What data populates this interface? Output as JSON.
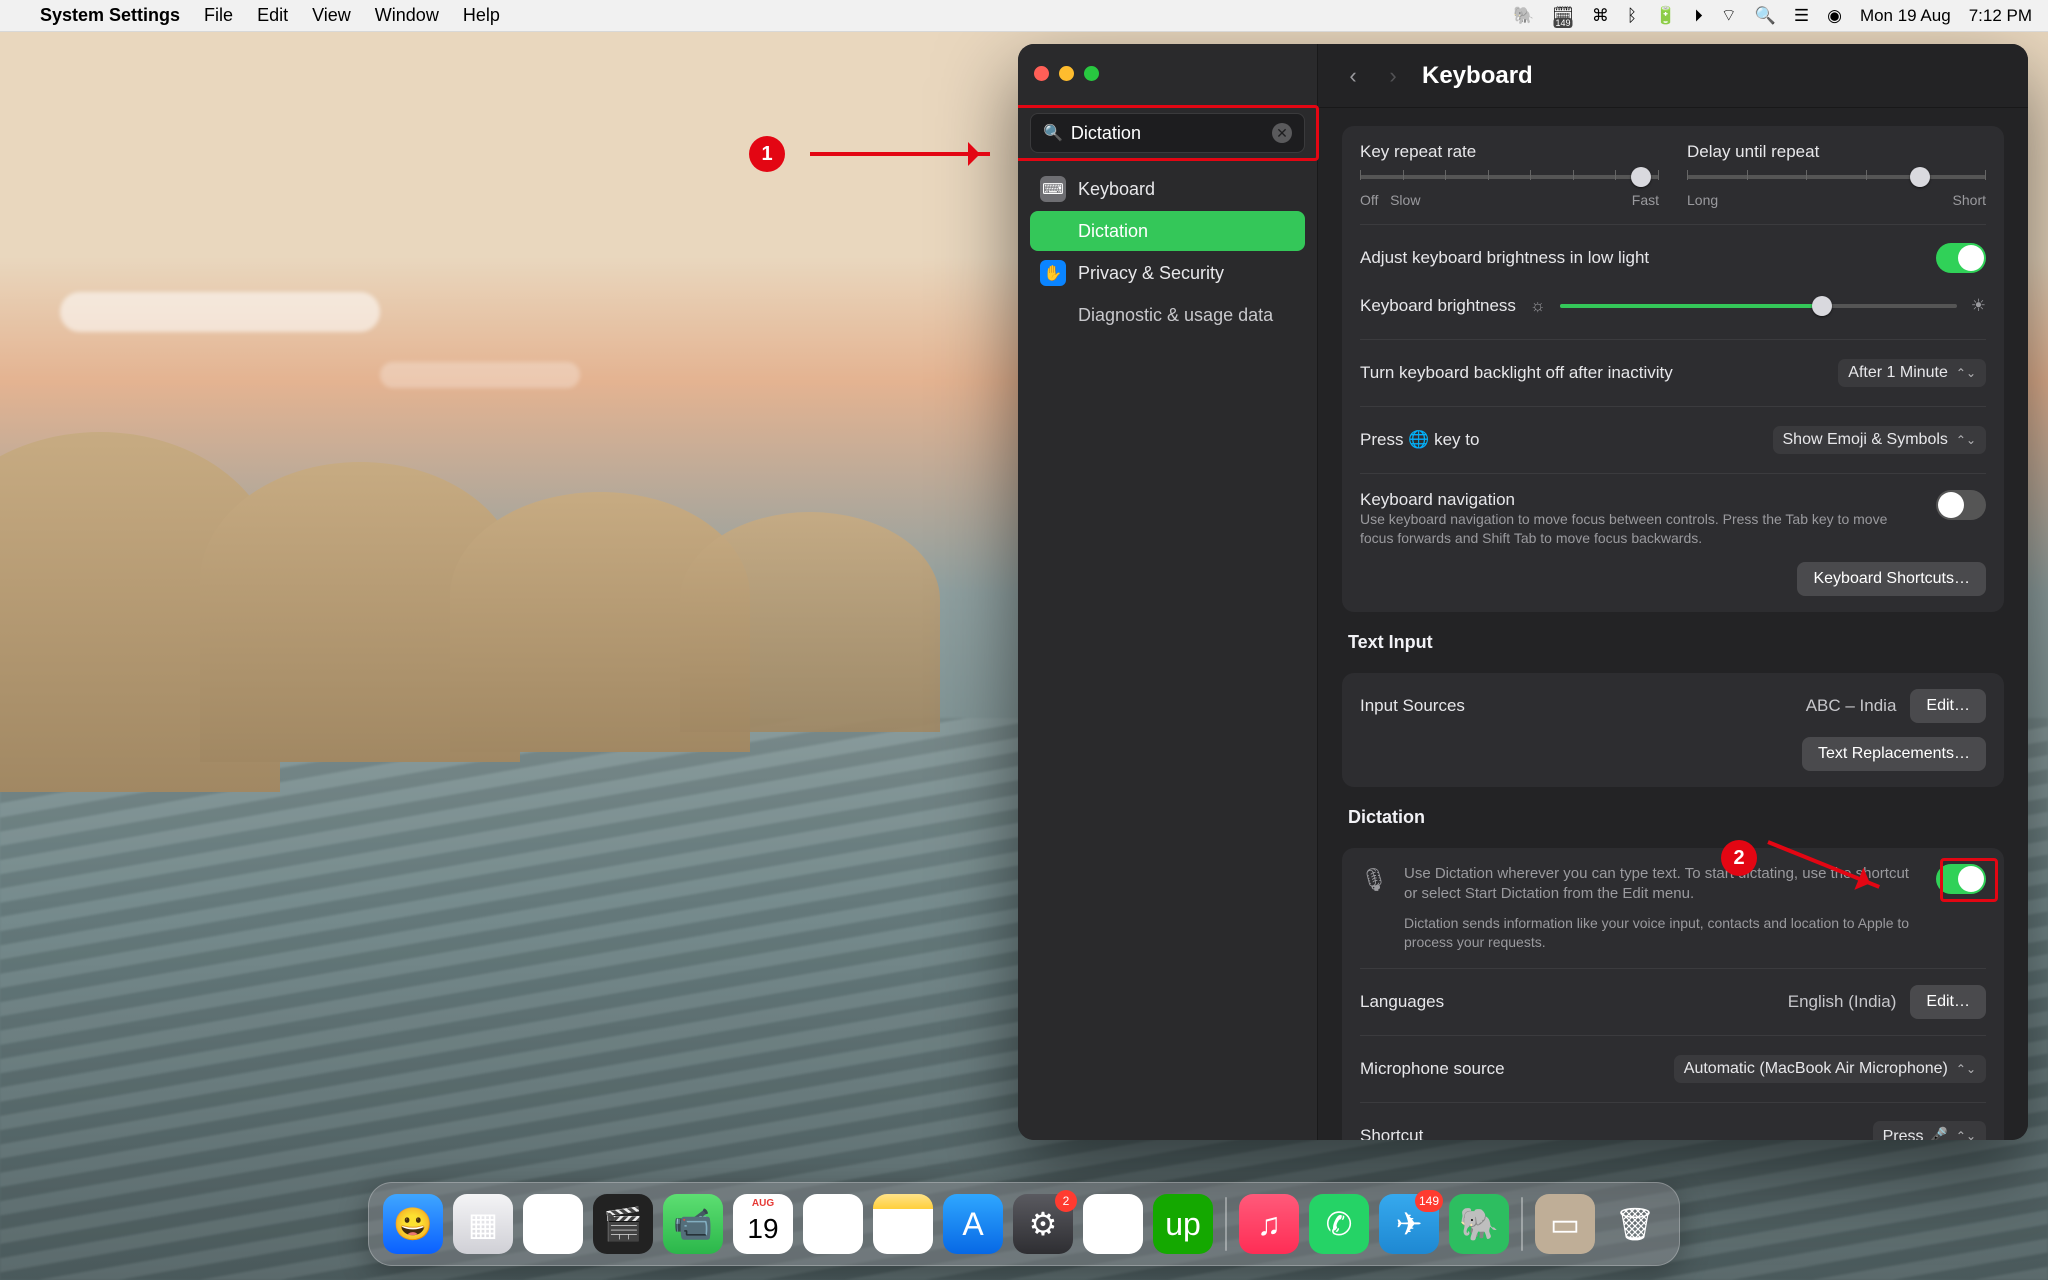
{
  "menubar": {
    "app": "System Settings",
    "items": [
      "File",
      "Edit",
      "View",
      "Window",
      "Help"
    ],
    "date": "Mon 19 Aug",
    "time": "7:12 PM",
    "calbadge": "149"
  },
  "sidebar": {
    "search_value": "Dictation",
    "items": [
      {
        "icon": "grey",
        "glyph": "⌨",
        "label": "Keyboard",
        "selected": false
      },
      {
        "icon": "",
        "glyph": "",
        "label": "Dictation",
        "selected": true
      },
      {
        "icon": "blue",
        "glyph": "✋",
        "label": "Privacy & Security",
        "selected": false
      },
      {
        "icon": "",
        "glyph": "",
        "label": "Diagnostic & usage data",
        "selected": false,
        "sub": true
      }
    ]
  },
  "header": {
    "title": "Keyboard"
  },
  "keycard": {
    "repeat_label": "Key repeat rate",
    "repeat_left": "Off",
    "repeat_left2": "Slow",
    "repeat_right": "Fast",
    "delay_label": "Delay until repeat",
    "delay_left": "Long",
    "delay_right": "Short",
    "brightauto_label": "Adjust keyboard brightness in low light",
    "bright_label": "Keyboard brightness",
    "backlightoff_label": "Turn keyboard backlight off after inactivity",
    "backlightoff_value": "After 1 Minute",
    "globe_label": "Press 🌐 key to",
    "globe_value": "Show Emoji & Symbols",
    "nav_label": "Keyboard navigation",
    "nav_help": "Use keyboard navigation to move focus between controls. Press the Tab key to move focus forwards and Shift Tab to move focus backwards.",
    "shortcuts_btn": "Keyboard Shortcuts…"
  },
  "textinput": {
    "title": "Text Input",
    "sources_label": "Input Sources",
    "sources_value": "ABC – India",
    "edit_btn": "Edit…",
    "replacements_btn": "Text Replacements…"
  },
  "dictation": {
    "title": "Dictation",
    "desc": "Use Dictation wherever you can type text. To start dictating, use the shortcut or select Start Dictation from the Edit menu.",
    "privacy": "Dictation sends information like your voice input, contacts and location to Apple to process your requests.",
    "lang_label": "Languages",
    "lang_value": "English (India)",
    "edit_btn": "Edit…",
    "mic_label": "Microphone source",
    "mic_value": "Automatic (MacBook Air Microphone)",
    "shortcut_label": "Shortcut",
    "shortcut_value": "Press 🎤"
  },
  "annotations": {
    "a1": "1",
    "a2": "2"
  },
  "dock": {
    "items": [
      {
        "name": "finder",
        "bg": "linear-gradient(#3fa6ff,#0a60ff)",
        "glyph": "😀"
      },
      {
        "name": "launchpad",
        "bg": "linear-gradient(#f4f4f6,#d0d0d6)",
        "glyph": "▦"
      },
      {
        "name": "chrome",
        "bg": "#fff",
        "glyph": "◎"
      },
      {
        "name": "final-cut",
        "bg": "#222",
        "glyph": "🎬"
      },
      {
        "name": "facetime",
        "bg": "linear-gradient(#5ddf72,#2bb74a)",
        "glyph": "📹"
      },
      {
        "name": "calendar",
        "bg": "#fff",
        "glyph": "19",
        "text": "#e53935",
        "top": "AUG"
      },
      {
        "name": "reminders",
        "bg": "#fff",
        "glyph": "☶"
      },
      {
        "name": "notes",
        "bg": "linear-gradient(#ffe38a,#ffcf3b 25%,#fff 25%)",
        "glyph": "≣"
      },
      {
        "name": "appstore",
        "bg": "linear-gradient(#2fa7ff,#0768e5)",
        "glyph": "A"
      },
      {
        "name": "settings",
        "bg": "linear-gradient(#5a5a60,#2e2e32)",
        "glyph": "⚙",
        "badge": "2"
      },
      {
        "name": "slack",
        "bg": "#fff",
        "glyph": "✱"
      },
      {
        "name": "upwork",
        "bg": "#14a800",
        "glyph": "up"
      }
    ],
    "recent": [
      {
        "name": "music",
        "bg": "linear-gradient(#ff5a7a,#ff2d55)",
        "glyph": "♫"
      },
      {
        "name": "whatsapp",
        "bg": "#25d366",
        "glyph": "✆"
      },
      {
        "name": "telegram",
        "bg": "linear-gradient(#36a9ee,#1e88d2)",
        "glyph": "✈",
        "badge": "149"
      },
      {
        "name": "evernote",
        "bg": "#2dbe60",
        "glyph": "🐘"
      }
    ],
    "extras": [
      {
        "name": "preview-doc",
        "bg": "#bfae97",
        "glyph": "▭"
      },
      {
        "name": "trash",
        "bg": "transparent",
        "glyph": "🗑"
      }
    ]
  }
}
